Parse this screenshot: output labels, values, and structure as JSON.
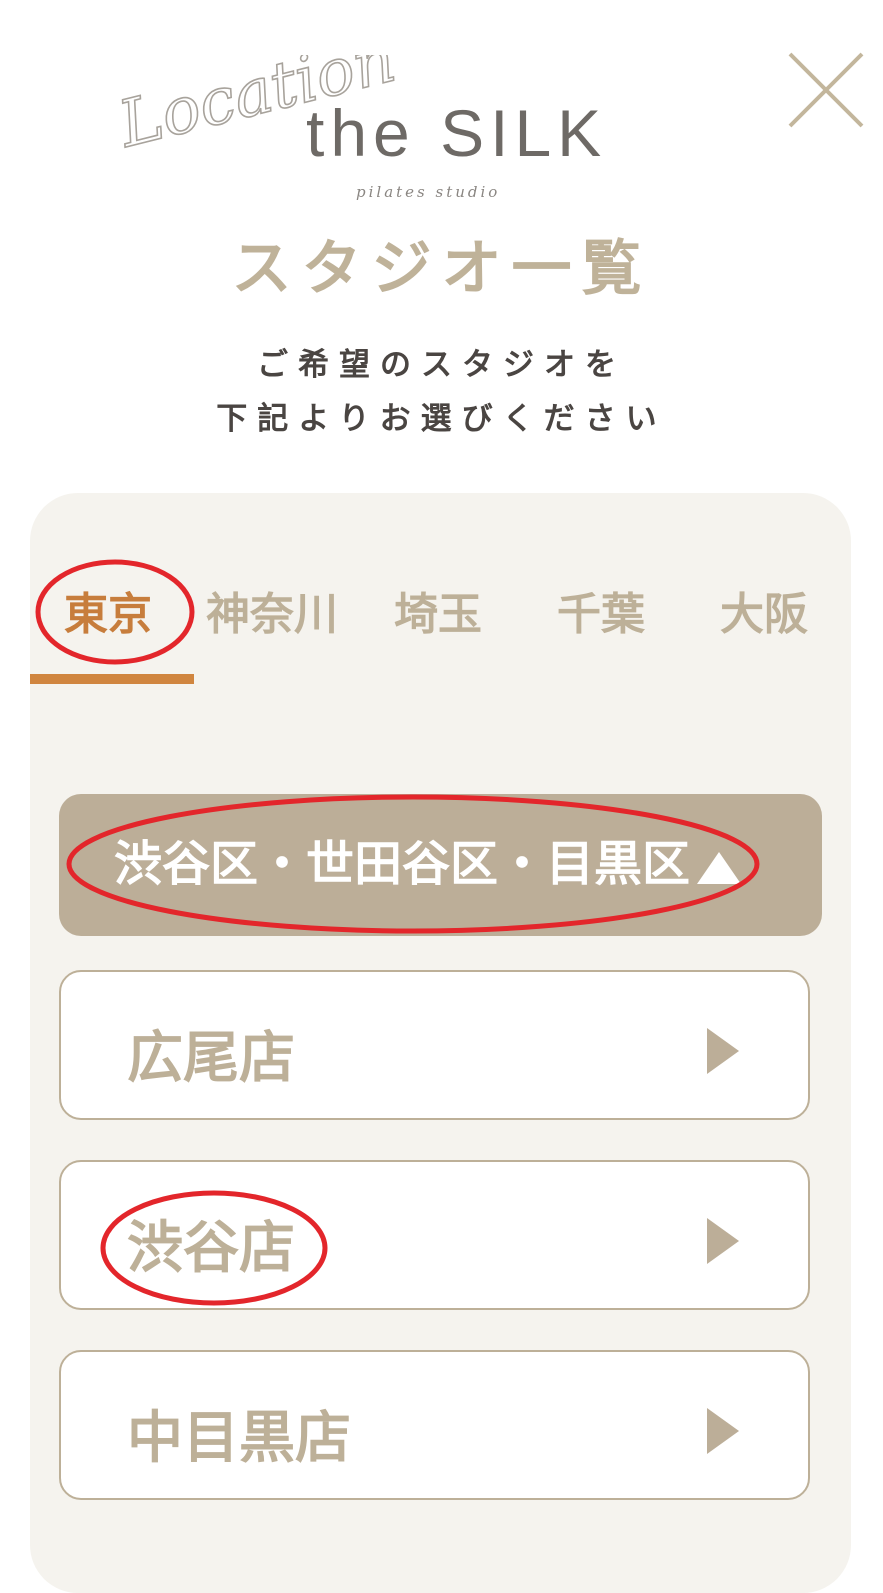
{
  "header": {
    "logo_script": "Location",
    "logo_main": "the SILK",
    "logo_sub": "pilates studio",
    "close_icon": "close-icon"
  },
  "page": {
    "title": "スタジオ一覧",
    "instruction_line1": "ご希望のスタジオを",
    "instruction_line2": "下記よりお選びください"
  },
  "tabs": [
    {
      "label": "東京",
      "active": true
    },
    {
      "label": "神奈川",
      "active": false
    },
    {
      "label": "埼玉",
      "active": false
    },
    {
      "label": "千葉",
      "active": false
    },
    {
      "label": "大阪",
      "active": false
    }
  ],
  "region": {
    "label": "渋谷区・世田谷区・目黒区",
    "arrow_icon": "triangle-up-icon"
  },
  "stores": [
    {
      "name": "広尾店",
      "arrow_icon": "triangle-right-icon"
    },
    {
      "name": "渋谷店",
      "arrow_icon": "triangle-right-icon"
    },
    {
      "name": "中目黒店",
      "arrow_icon": "triangle-right-icon"
    }
  ],
  "colors": {
    "accent": "#d0853f",
    "active_tab": "#c77d3c",
    "tab_inactive": "#bdb098",
    "region_bg": "#bcae98",
    "panel_bg": "#f5f3ee",
    "annotation": "#e3262b"
  }
}
